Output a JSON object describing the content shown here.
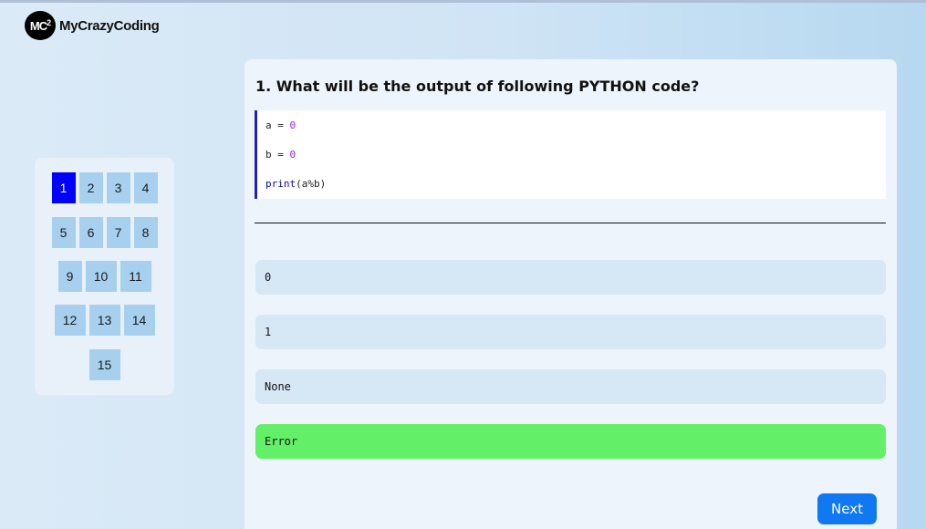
{
  "brand": {
    "badge": "MC",
    "badge_sup": "2",
    "name": "MyCrazyCoding"
  },
  "navigator": {
    "active": "1",
    "rows": [
      [
        "1",
        "2",
        "3",
        "4"
      ],
      [
        "5",
        "6",
        "7",
        "8"
      ],
      [
        "9",
        "10",
        "11"
      ],
      [
        "12",
        "13",
        "14"
      ],
      [
        "15"
      ]
    ]
  },
  "question": {
    "title": "1. What will be the output of following PYTHON code?",
    "code": {
      "line1_var": "a = ",
      "line1_val": "0",
      "line2_var": "b = ",
      "line2_val": "0",
      "line3_fn": "print",
      "line3_args": "(a%b)"
    },
    "options": [
      "0",
      "1",
      "None",
      "Error"
    ],
    "correct_option": "Error",
    "next_label": "Next"
  },
  "colors": {
    "active_question": "#0000ff",
    "question_button": "#a7d0ee",
    "option": "#d6e7f6",
    "correct_option": "#63ef67",
    "next_button": "#1078f0"
  }
}
